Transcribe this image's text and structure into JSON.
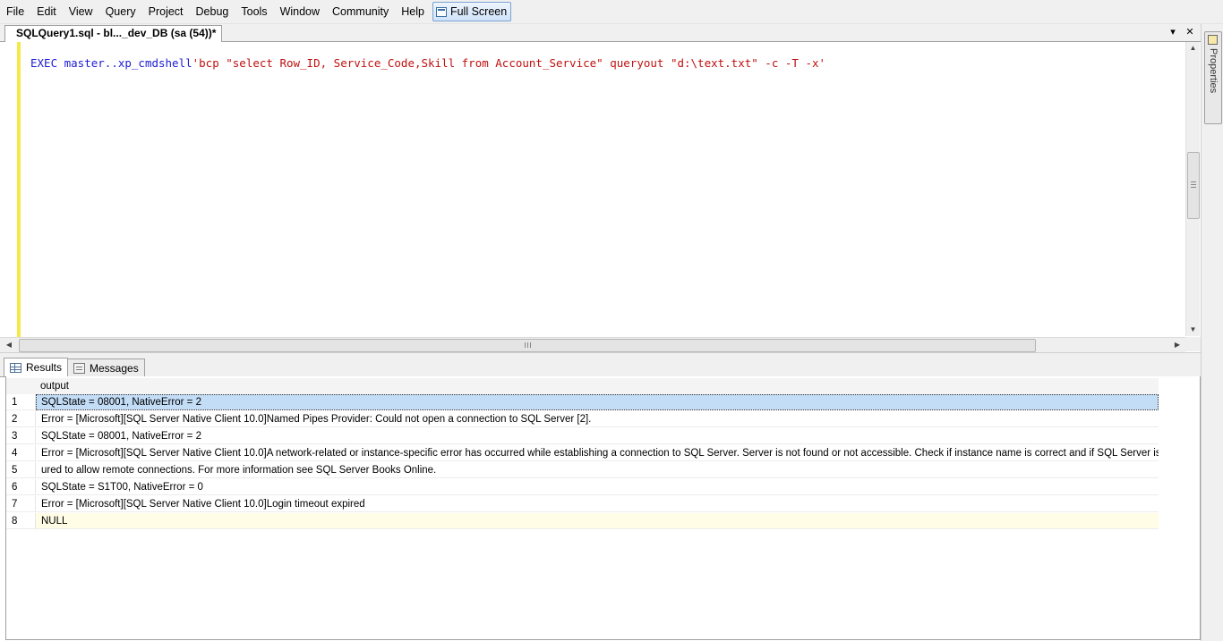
{
  "menu": [
    "File",
    "Edit",
    "View",
    "Query",
    "Project",
    "Debug",
    "Tools",
    "Window",
    "Community",
    "Help"
  ],
  "fullscreen_label": "Full Screen",
  "document_tab": {
    "title": "SQLQuery1.sql - bl..._dev_DB (sa (54))*",
    "dropdown_glyph": "▾",
    "close_glyph": "✕"
  },
  "properties_label": "Properties",
  "editor": {
    "keyword": "EXEC",
    "object": " master..xp_cmdshell",
    "string": "'bcp \"select Row_ID, Service_Code,Skill from Account_Service\" queryout \"d:\\text.txt\" -c -T -x'"
  },
  "results_tabs": {
    "results": "Results",
    "messages": "Messages"
  },
  "grid": {
    "column": "output",
    "rows": [
      {
        "num": "1",
        "value": "SQLState = 08001, NativeError = 2"
      },
      {
        "num": "2",
        "value": "Error = [Microsoft][SQL Server Native Client 10.0]Named Pipes Provider: Could not open a connection to SQL Server [2]."
      },
      {
        "num": "3",
        "value": "SQLState = 08001, NativeError = 2"
      },
      {
        "num": "4",
        "value": "Error = [Microsoft][SQL Server Native Client 10.0]A network-related or instance-specific error has occurred while establishing a connection to SQL Server. Server is not found or not accessible. Check if instance name is correct and if SQL Server is config"
      },
      {
        "num": "5",
        "value": "ured to allow remote connections. For more information see SQL Server Books Online."
      },
      {
        "num": "6",
        "value": "SQLState = S1T00, NativeError = 0"
      },
      {
        "num": "7",
        "value": "Error = [Microsoft][SQL Server Native Client 10.0]Login timeout expired"
      },
      {
        "num": "8",
        "value": "NULL"
      }
    ]
  }
}
